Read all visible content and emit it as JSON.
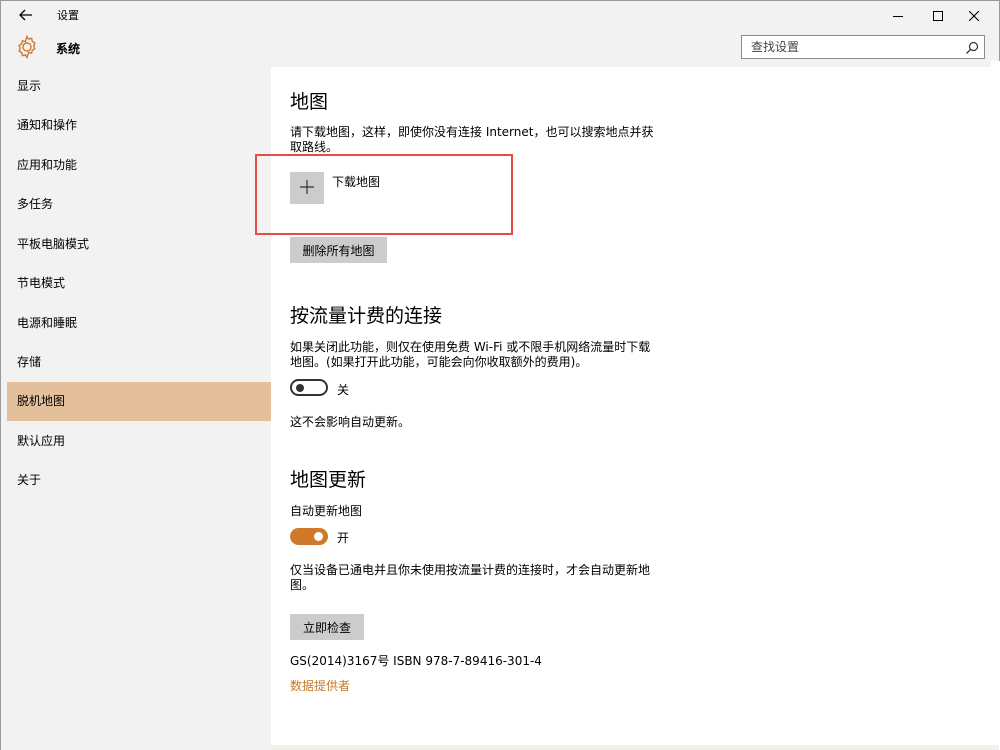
{
  "titlebar": {
    "title": "设置",
    "back_icon": "arrow-left-icon",
    "minimize_icon": "minimize-icon",
    "maximize_icon": "maximize-icon",
    "close_icon": "close-icon"
  },
  "header": {
    "section_title": "系统",
    "search_placeholder": "查找设置",
    "accent_color": "#d07a29"
  },
  "sidebar": {
    "items": [
      {
        "label": "显示"
      },
      {
        "label": "通知和操作"
      },
      {
        "label": "应用和功能"
      },
      {
        "label": "多任务"
      },
      {
        "label": "平板电脑模式"
      },
      {
        "label": "节电模式"
      },
      {
        "label": "电源和睡眠"
      },
      {
        "label": "存储"
      },
      {
        "label": "脱机地图"
      },
      {
        "label": "默认应用"
      },
      {
        "label": "关于"
      }
    ],
    "active_index": 8,
    "active_color": "#e3bf9c"
  },
  "maps": {
    "heading": "地图",
    "description": "请下载地图，这样，即使你没有连接 Internet，也可以搜索地点并获取路线。",
    "download_label": "下载地图",
    "delete_all_button": "删除所有地图"
  },
  "metered": {
    "heading": "按流量计费的连接",
    "description": "如果关闭此功能，则仅在使用免费 Wi-Fi 或不限手机网络流量时下载地图。(如果打开此功能，可能会向你收取额外的费用)。",
    "toggle_state": "off",
    "toggle_label": "关",
    "note": "这不会影响自动更新。"
  },
  "updates": {
    "heading": "地图更新",
    "auto_update_label": "自动更新地图",
    "toggle_state": "on",
    "toggle_label": "开",
    "description": "仅当设备已通电并且你未使用按流量计费的连接时，才会自动更新地图。",
    "check_now_button": "立即检查",
    "copyright": "GS(2014)3167号 ISBN 978-7-89416-301-4",
    "data_providers_link": "数据提供者"
  }
}
